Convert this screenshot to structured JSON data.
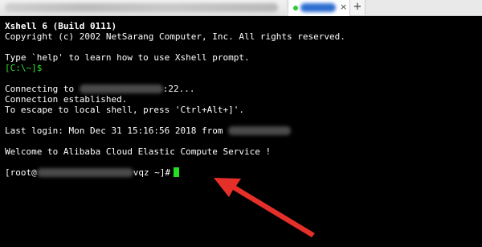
{
  "colors": {
    "terminal_background": "#000000",
    "terminal_text": "#ffffff",
    "prompt_green": "#35e335",
    "cursor_green": "#23e023",
    "status_dot_green": "#2ec92e",
    "annotation_arrow_red": "#e5302a"
  },
  "tabs": {
    "inactive_title_redacted": true,
    "active": {
      "status_icon": "green-status-dot",
      "title_redacted": true,
      "close_label": "×"
    },
    "new_tab_label": "+"
  },
  "terminal": {
    "banner": {
      "title": "Xshell 6 (Build 0111)",
      "copyright": "Copyright (c) 2002 NetSarang Computer, Inc. All rights reserved."
    },
    "help_hint": "Type `help' to learn how to use Xshell prompt.",
    "local_prompt": "[C:\\~]$",
    "connecting_prefix": "Connecting to ",
    "connecting_suffix": ":22...",
    "connection_established": "Connection established.",
    "escape_hint": "To escape to local shell, press 'Ctrl+Alt+]'.",
    "last_login": "Last login: Mon Dec 31 15:16:56 2018 from ",
    "welcome": "Welcome to Alibaba Cloud Elastic Compute Service !",
    "remote_prompt_prefix": "[root@",
    "remote_prompt_suffix": "vqz ~]#"
  },
  "annotation": {
    "icon": "red-arrow-pointing-to-prompt"
  }
}
